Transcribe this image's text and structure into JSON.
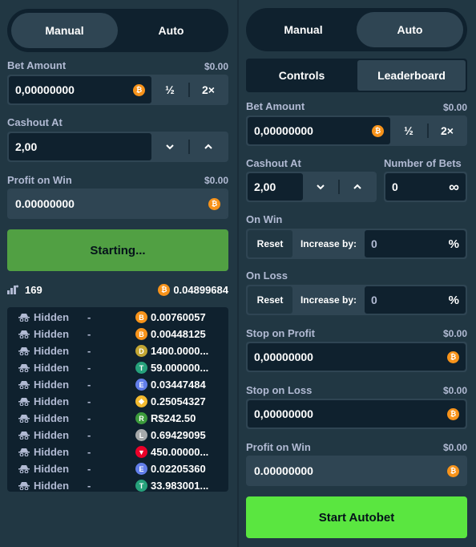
{
  "colors": {
    "background": "#213743",
    "field_dark": "#0f212e",
    "field_border": "#2f4553",
    "label": "#b1bad3",
    "starting_button": "#51a043",
    "autobet_button": "#5ae640",
    "bitcoin": "#f7931a"
  },
  "left": {
    "mode_tabs": {
      "manual": "Manual",
      "auto": "Auto",
      "active": "manual"
    },
    "bet_amount": {
      "label": "Bet Amount",
      "usd": "$0.00",
      "value": "0,00000000",
      "half": "½",
      "double": "2×"
    },
    "cashout": {
      "label": "Cashout At",
      "value": "2,00"
    },
    "profit": {
      "label": "Profit on Win",
      "usd": "$0.00",
      "value": "0.00000000"
    },
    "action_button": "Starting...",
    "stats": {
      "players": "169",
      "total": "0.04899684"
    },
    "bets": [
      {
        "user": "Hidden",
        "mult": "-",
        "amount": "0.00760057",
        "currency": "btc-icon",
        "color": "#f7931a",
        "glyph": "B"
      },
      {
        "user": "Hidden",
        "mult": "-",
        "amount": "0.00448125",
        "currency": "btc-icon",
        "color": "#f7931a",
        "glyph": "B"
      },
      {
        "user": "Hidden",
        "mult": "-",
        "amount": "1400.0000...",
        "currency": "doge-icon",
        "color": "#c2a633",
        "glyph": "D"
      },
      {
        "user": "Hidden",
        "mult": "-",
        "amount": "59.000000...",
        "currency": "usdt-icon",
        "color": "#26a17b",
        "glyph": "T"
      },
      {
        "user": "Hidden",
        "mult": "-",
        "amount": "0.03447484",
        "currency": "eth-icon",
        "color": "#627eea",
        "glyph": "E"
      },
      {
        "user": "Hidden",
        "mult": "-",
        "amount": "0.25054327",
        "currency": "bnb-icon",
        "color": "#f3ba2f",
        "glyph": "◆"
      },
      {
        "user": "Hidden",
        "mult": "-",
        "amount": "R$242.50",
        "currency": "brl-icon",
        "color": "#3c9b3c",
        "glyph": "R"
      },
      {
        "user": "Hidden",
        "mult": "-",
        "amount": "0.69429095",
        "currency": "ltc-icon",
        "color": "#a6a9aa",
        "glyph": "L"
      },
      {
        "user": "Hidden",
        "mult": "-",
        "amount": "450.00000...",
        "currency": "trx-icon",
        "color": "#eb0029",
        "glyph": "▼"
      },
      {
        "user": "Hidden",
        "mult": "-",
        "amount": "0.02205360",
        "currency": "eth-icon",
        "color": "#627eea",
        "glyph": "E"
      },
      {
        "user": "Hidden",
        "mult": "-",
        "amount": "33.983001...",
        "currency": "usdt-icon",
        "color": "#26a17b",
        "glyph": "T"
      }
    ]
  },
  "right": {
    "mode_tabs": {
      "manual": "Manual",
      "auto": "Auto",
      "active": "auto"
    },
    "sub_tabs": {
      "controls": "Controls",
      "leaderboard": "Leaderboard",
      "active": "leaderboard"
    },
    "bet_amount": {
      "label": "Bet Amount",
      "usd": "$0.00",
      "value": "0,00000000",
      "half": "½",
      "double": "2×"
    },
    "cashout": {
      "label": "Cashout At",
      "value": "2,00"
    },
    "num_bets": {
      "label": "Number of Bets",
      "value": "0",
      "infinity": "∞"
    },
    "on_win": {
      "label": "On Win",
      "reset": "Reset",
      "increase": "Increase by:",
      "value": "0",
      "pct": "%"
    },
    "on_loss": {
      "label": "On Loss",
      "reset": "Reset",
      "increase": "Increase by:",
      "value": "0",
      "pct": "%"
    },
    "stop_profit": {
      "label": "Stop on Profit",
      "usd": "$0.00",
      "value": "0,00000000"
    },
    "stop_loss": {
      "label": "Stop on Loss",
      "usd": "$0.00",
      "value": "0,00000000"
    },
    "profit": {
      "label": "Profit on Win",
      "usd": "$0.00",
      "value": "0.00000000"
    },
    "action_button": "Start Autobet"
  }
}
